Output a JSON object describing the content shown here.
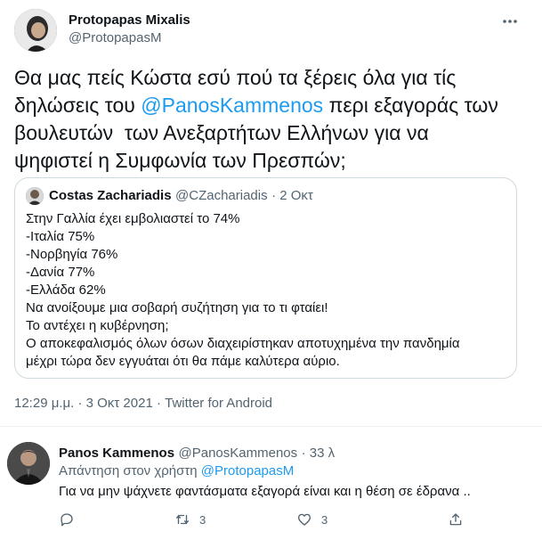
{
  "main_tweet": {
    "author_name": "Protopapas Mixalis",
    "author_handle": "@ProtopapasM",
    "text_line1": "Θα μας  πείς Κώστα εσύ πού τα ξέρεις όλα για τίς",
    "text_line2_before": "δηλώσεις του ",
    "text_line2_mention": "@PanosKammenos",
    "text_line2_after": " περι εξαγοράς των",
    "text_line3": "βουλευτών  των Ανεξαρτήτων Ελλήνων για να",
    "text_line4": "ψηφιστεί η Συμφωνία των Πρεσπών;",
    "timestamp": "12:29 μ.μ. · 3 Οκτ 2021 · Twitter for Android"
  },
  "quoted_tweet": {
    "author_name": "Costas Zachariadis",
    "author_handle": "@CZachariadis",
    "date": "· 2 Οκτ",
    "lines": [
      "Στην Γαλλία έχει εμβολιαστεί το 74%",
      "-Ιταλία 75%",
      "-Νορβηγία 76%",
      "-Δανία 77%",
      "-Ελλάδα 62%",
      "Να ανοίξουμε μια σοβαρή συζήτηση για το τι φταίει!",
      "Το αντέχει η κυβέρνηση;",
      "Ο αποκεφαλισμός όλων όσων διαχειρίστηκαν αποτυχημένα την πανδημία",
      "μέχρι τώρα δεν εγγυάται ότι θα πάμε καλύτερα αύριο."
    ]
  },
  "reply": {
    "author_name": "Panos Kammenos",
    "author_handle": "@PanosKammenos",
    "age": "· 33 λ",
    "replying_prefix": "Απάντηση στον χρήστη ",
    "replying_to": "@ProtopapasM",
    "text": "Για να μην ψάχνετε φαντάσματα εξαγορά είναι και η θέση σε έδρανα ..",
    "retweet_count": "3",
    "like_count": "3"
  },
  "colors": {
    "accent": "#1d9bf0",
    "secondary_text": "#536471",
    "border": "#cfd9de"
  },
  "icons": [
    "more-icon",
    "reply-icon",
    "retweet-icon",
    "like-icon",
    "share-icon"
  ]
}
